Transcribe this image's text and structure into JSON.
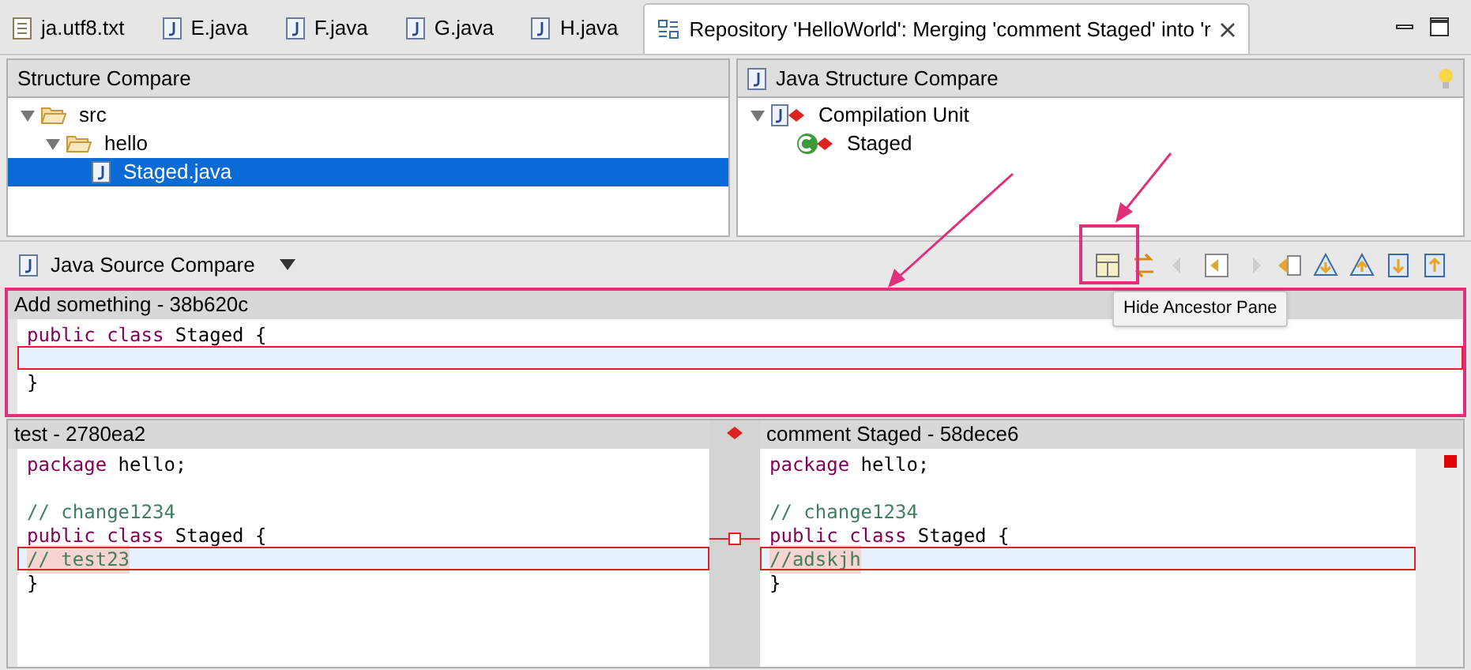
{
  "tabs": [
    {
      "label": "ja.utf8.txt",
      "kind": "text",
      "selected": false
    },
    {
      "label": "E.java",
      "kind": "java",
      "selected": false
    },
    {
      "label": "F.java",
      "kind": "java",
      "selected": false
    },
    {
      "label": "G.java",
      "kind": "java",
      "selected": false
    },
    {
      "label": "H.java",
      "kind": "java",
      "selected": false
    },
    {
      "label": "Repository 'HelloWorld': Merging 'comment Staged' into 'r",
      "kind": "compare",
      "selected": true
    }
  ],
  "structure_compare": {
    "title": "Structure Compare",
    "tree": [
      {
        "label": "src",
        "kind": "folder",
        "expanded": true,
        "selected": false,
        "children": [
          {
            "label": "hello",
            "kind": "folder",
            "expanded": true,
            "selected": false,
            "children": [
              {
                "label": "Staged.java",
                "kind": "java",
                "selected": true
              }
            ]
          }
        ]
      }
    ]
  },
  "java_structure_compare": {
    "title": "Java Structure Compare",
    "tree": [
      {
        "label": "Compilation Unit",
        "kind": "unit",
        "expanded": true,
        "selected": false,
        "children": [
          {
            "label": "Staged",
            "kind": "class",
            "selected": false
          }
        ]
      }
    ]
  },
  "source_compare": {
    "title": "Java Source Compare",
    "tooltip": "Hide Ancestor Pane"
  },
  "ancestor": {
    "title": "Add something - 38b620c",
    "lines": [
      {
        "changed": false,
        "tokens": [
          {
            "kind": "keyword",
            "text": "public class "
          },
          {
            "kind": "plain",
            "text": "Staged {"
          }
        ]
      },
      {
        "changed": true
      },
      {
        "changed": false,
        "tokens": [
          {
            "kind": "plain",
            "text": "}"
          }
        ]
      }
    ]
  },
  "left": {
    "title": "test - 2780ea2",
    "lines": [
      {
        "changed": false,
        "tokens": [
          {
            "kind": "keyword",
            "text": "package "
          },
          {
            "kind": "plain",
            "text": "hello;"
          }
        ]
      },
      {
        "changed": false
      },
      {
        "changed": false,
        "tokens": [
          {
            "kind": "comment",
            "text": "// change1234"
          }
        ]
      },
      {
        "changed": false,
        "tokens": [
          {
            "kind": "keyword",
            "text": "public class "
          },
          {
            "kind": "plain",
            "text": "Staged {"
          }
        ]
      },
      {
        "changed": true,
        "tokens": [
          {
            "kind": "comment",
            "text": "// test23"
          }
        ]
      },
      {
        "changed": false,
        "tokens": [
          {
            "kind": "plain",
            "text": "}"
          }
        ]
      }
    ]
  },
  "right": {
    "title": "comment Staged - 58dece6",
    "lines": [
      {
        "changed": false,
        "tokens": [
          {
            "kind": "keyword",
            "text": "package "
          },
          {
            "kind": "plain",
            "text": "hello;"
          }
        ]
      },
      {
        "changed": false
      },
      {
        "changed": false,
        "tokens": [
          {
            "kind": "comment",
            "text": "// change1234"
          }
        ]
      },
      {
        "changed": false,
        "tokens": [
          {
            "kind": "keyword",
            "text": "public class "
          },
          {
            "kind": "plain",
            "text": "Staged {"
          }
        ]
      },
      {
        "changed": true,
        "tokens": [
          {
            "kind": "comment",
            "text": "//adskjh"
          }
        ]
      },
      {
        "changed": false,
        "tokens": [
          {
            "kind": "plain",
            "text": "}"
          }
        ]
      }
    ]
  }
}
